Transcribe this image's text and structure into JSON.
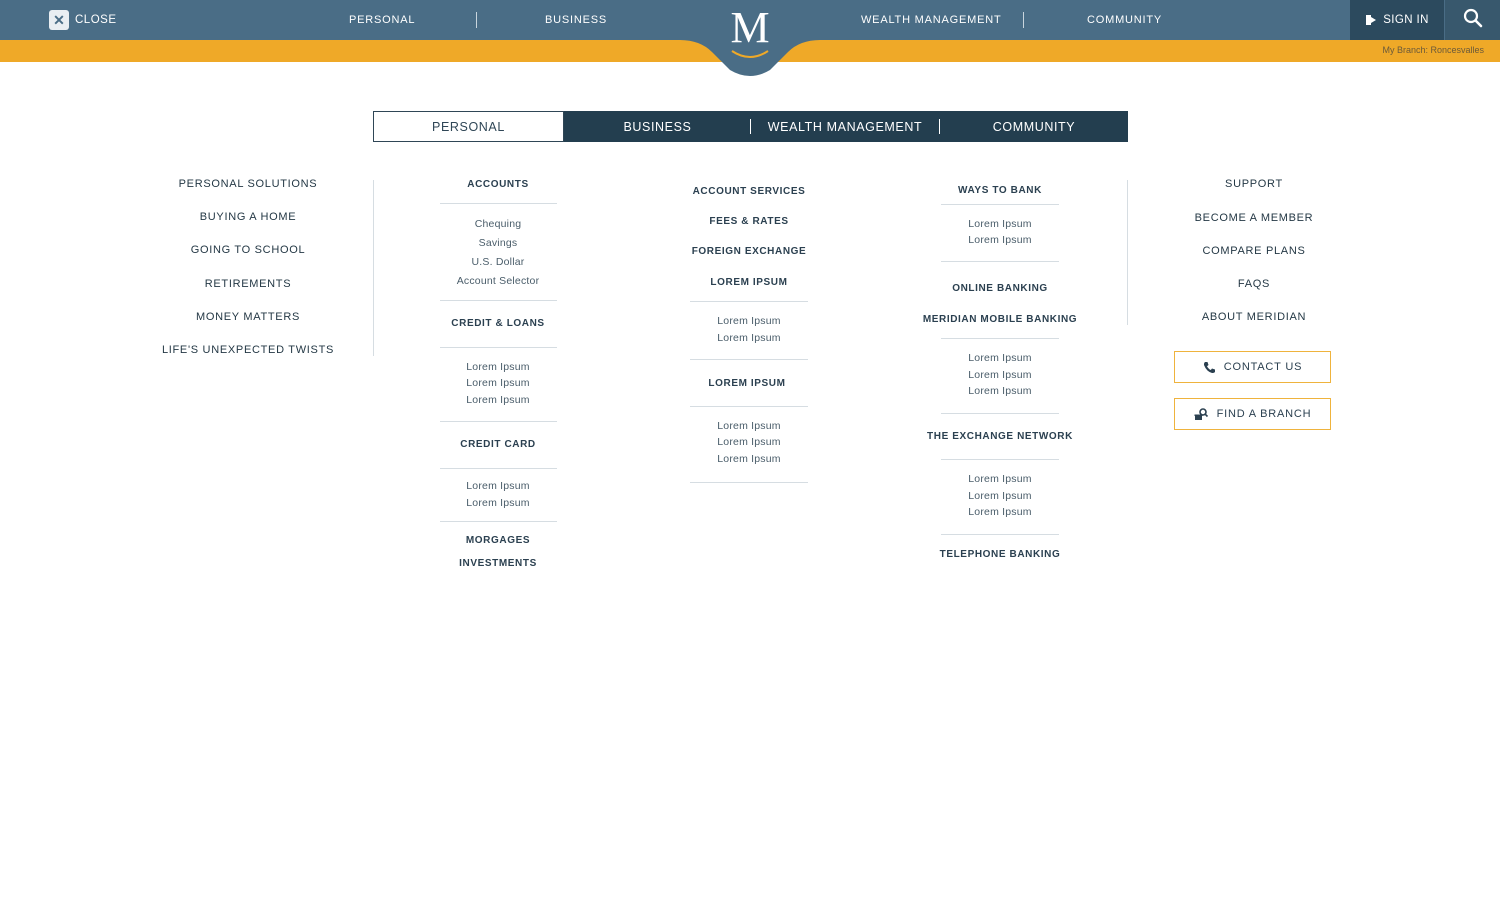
{
  "header": {
    "close_label": "CLOSE",
    "nav": [
      "PERSONAL",
      "BUSINESS",
      "WEALTH MANAGEMENT",
      "COMMUNITY"
    ],
    "logo_letter": "M",
    "sign_in_label": "SIGN IN",
    "branch_text": "My Branch: Roncesvalles",
    "colors": {
      "bar": "#4a6d86",
      "accent": "#efa928",
      "dark": "#233e4f"
    }
  },
  "tabs": [
    {
      "label": "PERSONAL",
      "active": true
    },
    {
      "label": "BUSINESS",
      "active": false
    },
    {
      "label": "WEALTH MANAGEMENT",
      "active": false
    },
    {
      "label": "COMMUNITY",
      "active": false
    }
  ],
  "left_menu": [
    "PERSONAL SOLUTIONS",
    "BUYING A HOME",
    "GOING TO SCHOOL",
    "RETIREMENTS",
    "MONEY MATTERS",
    "LIFE'S UNEXPECTED TWISTS"
  ],
  "col1": {
    "accounts": {
      "heading": "ACCOUNTS",
      "items": [
        "Chequing",
        "Savings",
        "U.S. Dollar",
        "Account Selector"
      ]
    },
    "credit_loans": {
      "heading": "CREDIT & LOANS",
      "items": [
        "Lorem Ipsum",
        "Lorem Ipsum",
        "Lorem Ipsum"
      ]
    },
    "credit_card": {
      "heading": "CREDIT CARD",
      "items": [
        "Lorem Ipsum",
        "Lorem Ipsum"
      ]
    },
    "morgages": "MORGAGES",
    "investments": "INVESTMENTS"
  },
  "col2": {
    "account_services": "ACCOUNT SERVICES",
    "fees_rates": "FEES & RATES",
    "foreign_exchange": "FOREIGN EXCHANGE",
    "lorem1": {
      "heading": "LOREM IPSUM",
      "items": [
        "Lorem Ipsum",
        "Lorem Ipsum"
      ]
    },
    "lorem2": {
      "heading": "LOREM IPSUM",
      "items": [
        "Lorem Ipsum",
        "Lorem Ipsum",
        "Lorem Ipsum"
      ]
    }
  },
  "col3": {
    "ways": {
      "heading": "WAYS TO BANK",
      "items": [
        "Lorem Ipsum",
        "Lorem Ipsum"
      ]
    },
    "online_banking": "ONLINE BANKING",
    "mobile": {
      "heading": "MERIDIAN MOBILE BANKING",
      "items": [
        "Lorem Ipsum",
        "Lorem Ipsum",
        "Lorem Ipsum"
      ]
    },
    "exchange": {
      "heading": "THE EXCHANGE NETWORK",
      "items": [
        "Lorem Ipsum",
        "Lorem Ipsum",
        "Lorem Ipsum"
      ]
    },
    "telephone": "TELEPHONE BANKING"
  },
  "right_menu": [
    "SUPPORT",
    "BECOME A MEMBER",
    "COMPARE PLANS",
    "FAQS",
    "ABOUT MERIDIAN"
  ],
  "buttons": {
    "contact": "CONTACT US",
    "branch": "FIND A BRANCH"
  },
  "icons": [
    "close-icon",
    "sign-in-icon",
    "search-icon",
    "phone-icon",
    "find-branch-icon"
  ]
}
